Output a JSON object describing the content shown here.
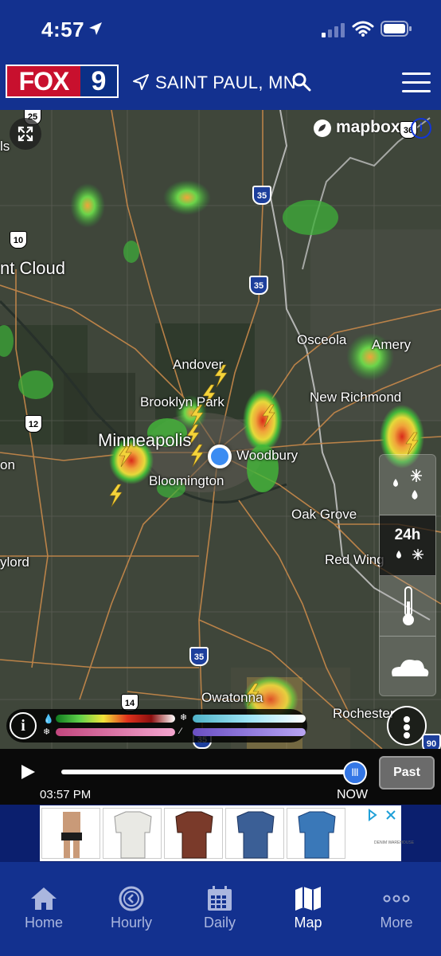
{
  "status_bar": {
    "time": "4:57",
    "icons": [
      "location-arrow-icon",
      "cellular-signal-icon",
      "wifi-icon",
      "battery-icon"
    ]
  },
  "header": {
    "logo_fox": "FOX",
    "logo_number": "9",
    "location": "SAINT PAUL, MN",
    "icons": [
      "location-arrow-icon",
      "search-icon",
      "hamburger-menu-icon"
    ]
  },
  "map": {
    "attribution_logo": "mapbox",
    "attribution_button": "i",
    "labels": [
      {
        "text": "ls"
      },
      {
        "text": "nt Cloud"
      },
      {
        "text": "Andover"
      },
      {
        "text": "Brooklyn Park"
      },
      {
        "text": "Minneapolis"
      },
      {
        "text": "Bloomington"
      },
      {
        "text": "Woodbury"
      },
      {
        "text": "Osceola"
      },
      {
        "text": "Amery"
      },
      {
        "text": "New Richmond"
      },
      {
        "text": "Oak Grove"
      },
      {
        "text": "Red Wing"
      },
      {
        "text": "ylord"
      },
      {
        "text": "on"
      },
      {
        "text": "Owatonna"
      },
      {
        "text": "Rochester"
      }
    ],
    "shields": [
      {
        "text": "25",
        "kind": "us"
      },
      {
        "text": "35",
        "kind": "interstate"
      },
      {
        "text": "10",
        "kind": "us"
      },
      {
        "text": "35",
        "kind": "interstate"
      },
      {
        "text": "12",
        "kind": "us"
      },
      {
        "text": "35",
        "kind": "interstate"
      },
      {
        "text": "14",
        "kind": "us"
      },
      {
        "text": "35",
        "kind": "interstate"
      },
      {
        "text": "36",
        "kind": "us"
      },
      {
        "text": "90",
        "kind": "interstate"
      }
    ],
    "layer_controls": [
      {
        "label": "",
        "icon": "rain-snow-icon"
      },
      {
        "label": "24h",
        "icon": "rain-snow-icon",
        "active": true
      },
      {
        "label": "",
        "icon": "thermometer-icon"
      },
      {
        "label": "",
        "icon": "cloud-icon"
      }
    ],
    "legend": {
      "info": "i",
      "rain_colors": [
        "#0f7a1f",
        "#5fd14a",
        "#f2e33a",
        "#e0321c",
        "#8b0f0f",
        "#ffffff"
      ],
      "snow_colors": [
        "#4fb2c8",
        "#9fe5f5",
        "#ffffff"
      ],
      "mix_colors": [
        "#c2477e",
        "#f4a6cf"
      ],
      "ice_colors": [
        "#6a4fc4",
        "#b9a5f2"
      ]
    }
  },
  "timeline": {
    "start_time": "03:57 PM",
    "end_label": "NOW",
    "past_button": "Past",
    "progress_fraction": 1.0,
    "thumb_glyph": "|||"
  },
  "ad": {
    "brand": "DENIM WAREHOUSE"
  },
  "tabs": [
    {
      "label": "Home",
      "icon": "home-icon"
    },
    {
      "label": "Hourly",
      "icon": "clock-icon"
    },
    {
      "label": "Daily",
      "icon": "calendar-icon"
    },
    {
      "label": "Map",
      "icon": "map-icon",
      "active": true
    },
    {
      "label": "More",
      "icon": "more-dots-icon"
    }
  ],
  "colors": {
    "brand_blue": "#13318f",
    "fox_red": "#c8102e",
    "location_blue": "#3b8cf2"
  }
}
